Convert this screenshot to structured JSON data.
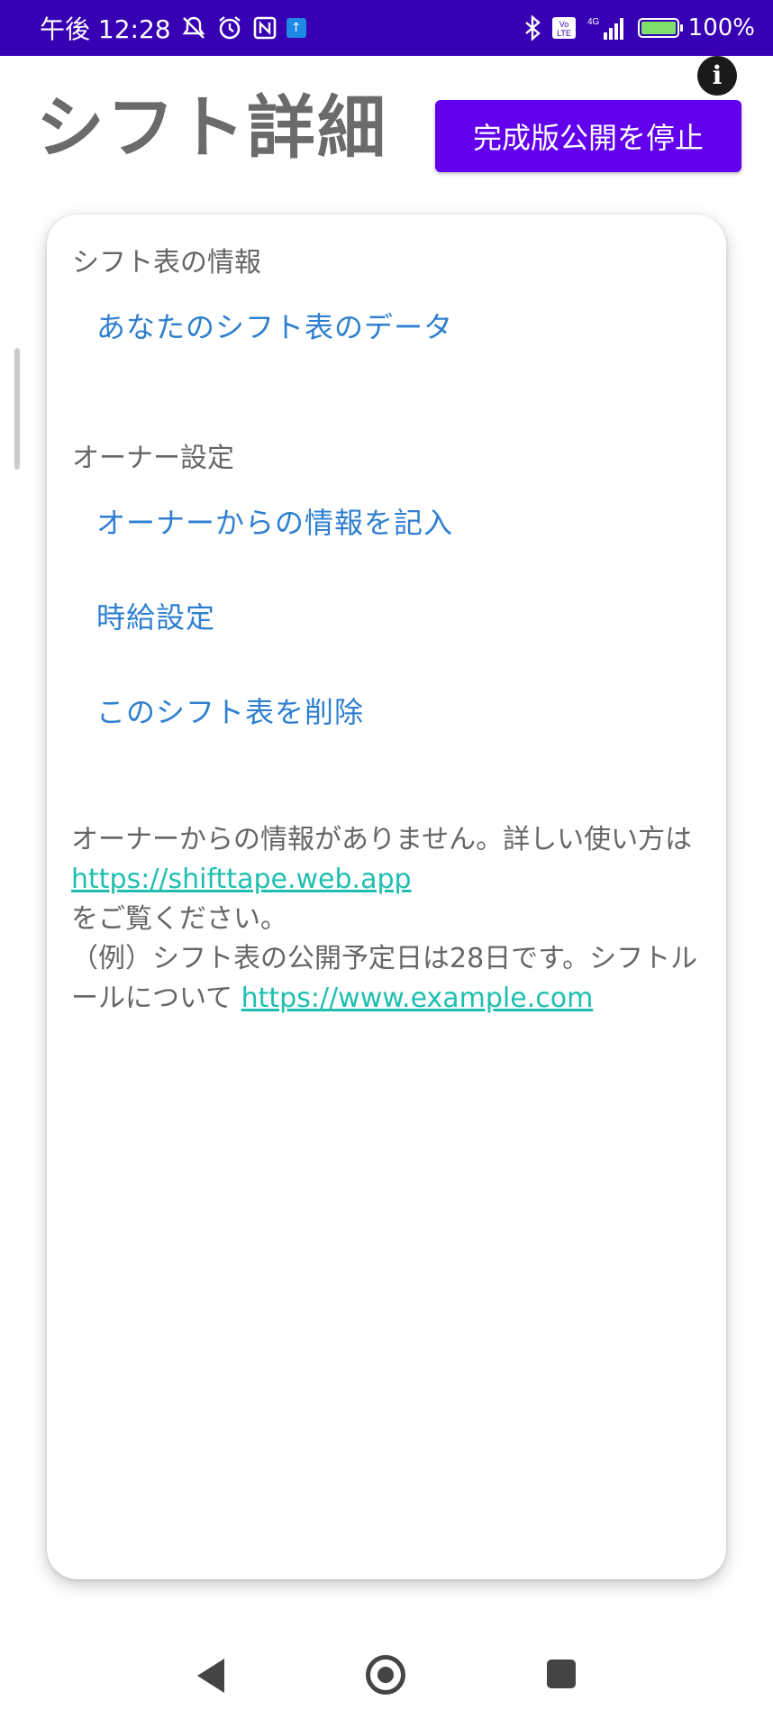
{
  "status_bar": {
    "time": "午後 12:28",
    "battery": "100%",
    "network": "4G",
    "volte": "Vo LTE"
  },
  "header": {
    "title": "シフト詳細",
    "publish_button": "完成版公開を停止",
    "info_button": "i"
  },
  "card": {
    "section_info_title": "シフト表の情報",
    "info_links": [
      "あなたのシフト表のデータ"
    ],
    "section_owner_title": "オーナー設定",
    "owner_links": [
      "オーナーからの情報を記入",
      "時給設定",
      "このシフト表を削除"
    ],
    "notice": {
      "line1": "オーナーからの情報がありません。詳しい使い方は",
      "link1": "https://shifttape.web.app",
      "line2": "をご覧ください。",
      "line3": "（例）シフト表の公開予定日は28日です。シフトルールについて ",
      "link2": "https://www.example.com"
    }
  },
  "colors": {
    "status_bar": "#3700b3",
    "primary_button": "#6200ee",
    "menu_link": "#2f7fd0",
    "url_link": "#1fbfb0"
  }
}
